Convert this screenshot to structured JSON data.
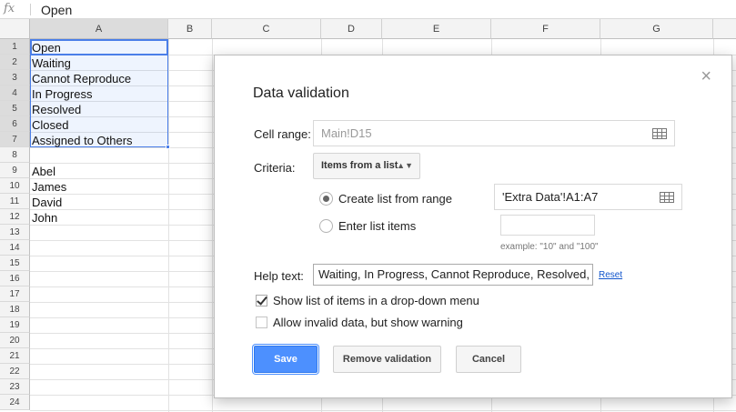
{
  "formula_bar": {
    "fx_icon": "fx",
    "value": "Open"
  },
  "columns": [
    "A",
    "B",
    "C",
    "D",
    "E",
    "F",
    "G"
  ],
  "rows": [
    "1",
    "2",
    "3",
    "4",
    "5",
    "6",
    "7",
    "8",
    "9",
    "10",
    "11",
    "12",
    "13",
    "14",
    "15",
    "16",
    "17",
    "18",
    "19",
    "20",
    "21",
    "22",
    "23",
    "24"
  ],
  "cells_a": [
    "Open",
    "Waiting",
    "Cannot Reproduce",
    "In Progress",
    "Resolved",
    "Closed",
    "Assigned to Others",
    "",
    "Abel",
    "James",
    "David",
    "John"
  ],
  "dialog": {
    "title": "Data validation",
    "close_icon": "×",
    "cell_range_label": "Cell range:",
    "cell_range_value": "Main!D15",
    "criteria_label": "Criteria:",
    "criteria_value": "Items from a list",
    "criteria_arrow": "▲▼",
    "option_range_label": "Create list from range",
    "option_range_value": "'Extra Data'!A1:A7",
    "option_items_label": "Enter list items",
    "option_items_value": "",
    "example_text": "example: \"10\" and \"100\"",
    "help_label": "Help text:",
    "help_value": "Waiting, In Progress, Cannot Reproduce, Resolved,",
    "reset_label": "Reset",
    "show_dropdown_label": "Show list of items in a drop-down menu",
    "allow_invalid_label": "Allow invalid data, but show warning",
    "save_label": "Save",
    "remove_label": "Remove validation",
    "cancel_label": "Cancel"
  }
}
